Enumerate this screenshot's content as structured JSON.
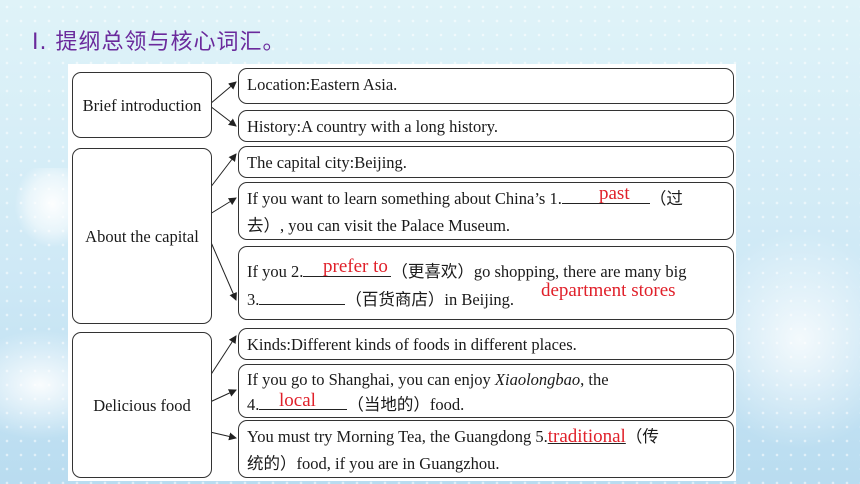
{
  "title": "Ⅰ. 提纲总领与核心词汇。",
  "sections": {
    "intro": {
      "label": "Brief introduction",
      "items": [
        "Location:Eastern Asia.",
        "History:A country with a long history."
      ]
    },
    "capital": {
      "label": "About the capital",
      "item1": "The capital city:Beijing.",
      "item2_a": "If you want to learn something about China’s 1.",
      "item2_b": "（过",
      "item2_c": "去）, you can visit the Palace Museum.",
      "item2_answer": "past",
      "item3_a": "If you 2.",
      "item3_b": "（更喜欢）go shopping, there are many big",
      "item3_c": "3.",
      "item3_d": "（百货商店）in Beijing.",
      "item3_answer1": "prefer to",
      "item3_answer2": "department stores"
    },
    "food": {
      "label": "Delicious food",
      "item1": "Kinds:Different kinds of foods in different places.",
      "item2_a": "If you go to Shanghai, you can enjoy ",
      "item2_italic": "Xiaolongbao",
      "item2_b": ", the",
      "item2_c": "4.",
      "item2_d": "（当地的）food.",
      "item2_answer": "local",
      "item3_a": "You must try Morning Tea, the Guangdong 5.",
      "item3_answer": "traditional",
      "item3_b": "（传",
      "item3_c": "统的）food, if you are in Guangzhou."
    }
  }
}
